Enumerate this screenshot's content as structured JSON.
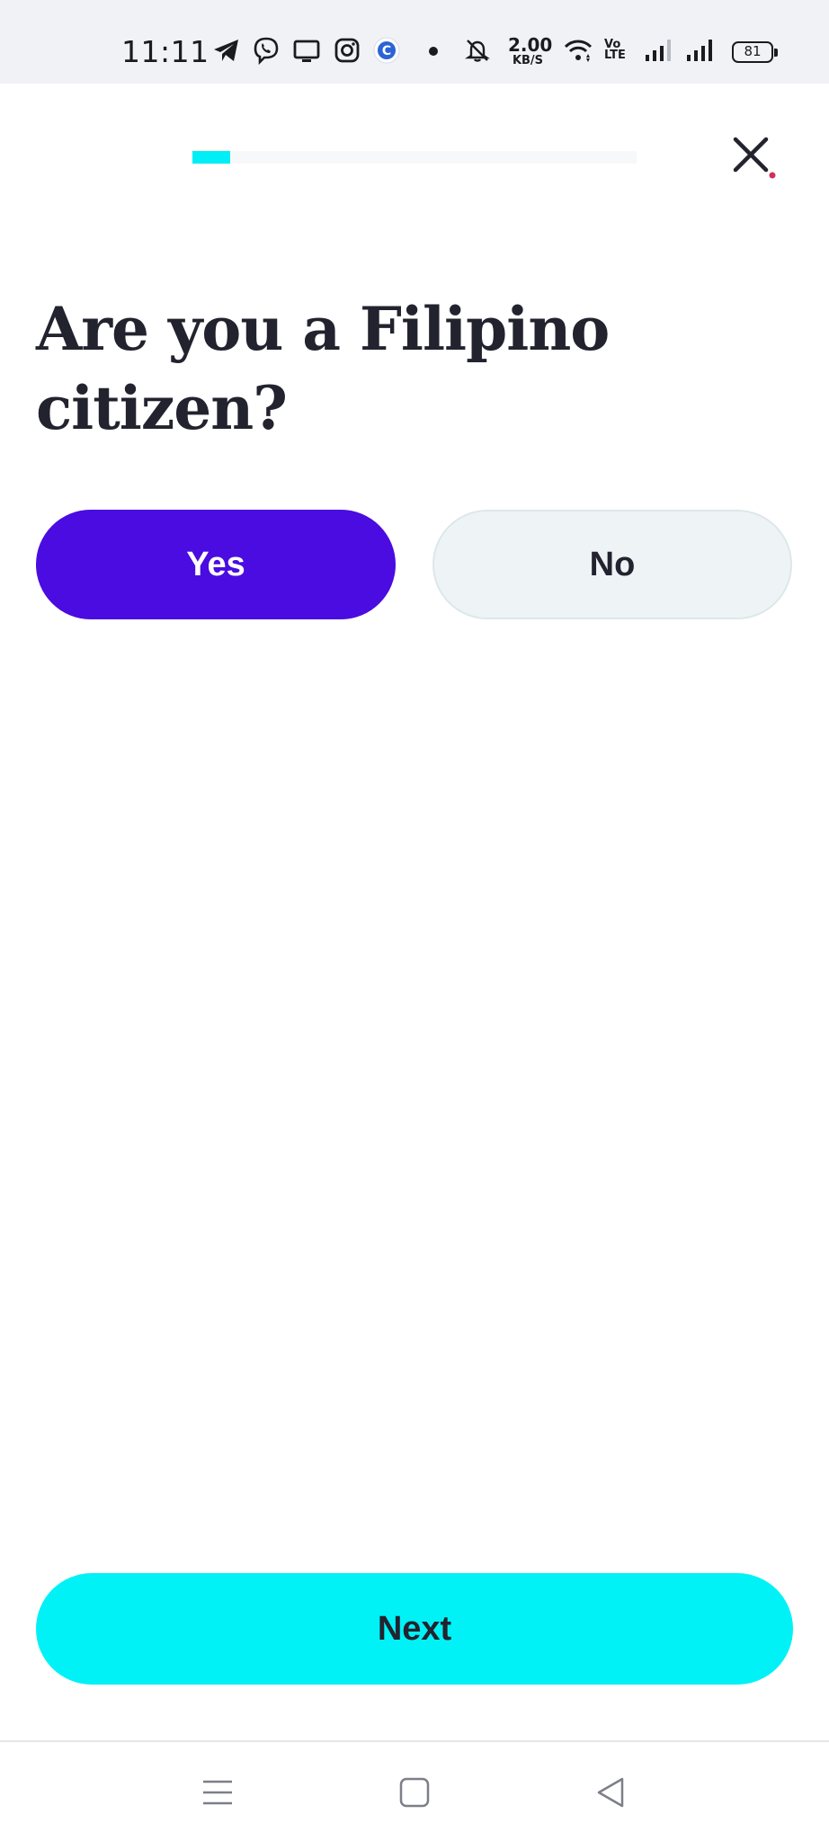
{
  "status_bar": {
    "time": "11:11",
    "net_speed_value": "2.00",
    "net_speed_unit": "KB/S",
    "volte_top": "Vo",
    "volte_bottom": "LTE",
    "battery": "81",
    "icons": [
      "telegram-icon",
      "viber-icon",
      "screen-cast-icon",
      "instagram-icon",
      "c-app-icon",
      "notification-dot-icon",
      "muted-bell-icon",
      "wifi-icon",
      "signal-icon",
      "signal-icon",
      "battery-icon"
    ]
  },
  "header": {
    "progress_fraction": 0.085,
    "close_icon": "close-icon",
    "close_dot_color": "#d0305a"
  },
  "question": {
    "title": "Are you a Filipino citizen?"
  },
  "options": {
    "yes_label": "Yes",
    "no_label": "No",
    "selected": "Yes"
  },
  "footer": {
    "next_label": "Next"
  },
  "nav_bar": {
    "icons": [
      "menu-icon",
      "home-square-icon",
      "back-triangle-icon"
    ]
  },
  "colors": {
    "accent_purple": "#4a0ce1",
    "accent_cyan": "#00f2f6",
    "text_dark": "#23232f"
  }
}
